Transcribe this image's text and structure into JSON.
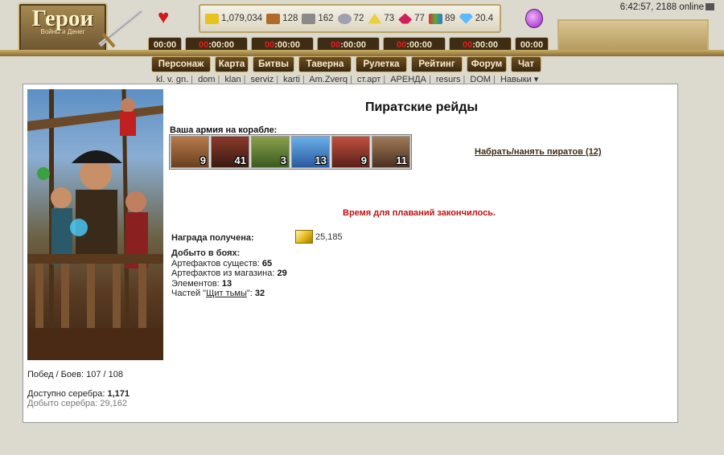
{
  "header": {
    "logo_title": "Герои",
    "logo_subtitle": "Войны и Денег",
    "clock": "6:42:57, 2188 online",
    "resources": [
      {
        "name": "gold",
        "value": "1,079,034",
        "color": "#e6c223"
      },
      {
        "name": "wood",
        "value": "128",
        "color": "#b06a2a"
      },
      {
        "name": "ore",
        "value": "162",
        "color": "#8a8a8a"
      },
      {
        "name": "mercury",
        "value": "72",
        "color": "#a0a0b0"
      },
      {
        "name": "sulfur",
        "value": "73",
        "color": "#e8d040"
      },
      {
        "name": "crystal",
        "value": "77",
        "color": "#d0205a"
      },
      {
        "name": "gems",
        "value": "89",
        "color": "#50b040"
      },
      {
        "name": "diamonds",
        "value": "20.4",
        "color": "#5ab8ff"
      }
    ],
    "timers": [
      {
        "prefix": "",
        "time": "00:00"
      },
      {
        "prefix": "00",
        "time": ":00:00"
      },
      {
        "prefix": "00",
        "time": ":00:00"
      },
      {
        "prefix": "00",
        "time": ":00:00"
      },
      {
        "prefix": "00",
        "time": ":00:00"
      },
      {
        "prefix": "00",
        "time": ":00:00"
      },
      {
        "prefix": "",
        "time": "00:00"
      }
    ],
    "nav": [
      "Персонаж",
      "Карта",
      "Битвы",
      "Таверна",
      "Рулетка",
      "Рейтинг",
      "Форум",
      "Чат"
    ],
    "links": [
      "kl. v. gn.",
      "dom",
      "klan",
      "serviz",
      "karti",
      "Am.Zverq",
      "ст.арт",
      "АРЕНДА",
      "resurs",
      "DOM",
      "Навыки ▾"
    ]
  },
  "main": {
    "title": "Пиратские рейды",
    "army_label": "Ваша армия на корабле:",
    "units": [
      {
        "name": "pirate-brawler",
        "count": "9",
        "color": "#b87a4a"
      },
      {
        "name": "pirate-captain",
        "count": "41",
        "color": "#8a3a2a"
      },
      {
        "name": "lizard-warrior",
        "count": "3",
        "color": "#6a8a3a"
      },
      {
        "name": "sea-bird",
        "count": "13",
        "color": "#3a7ac0"
      },
      {
        "name": "corsair",
        "count": "9",
        "color": "#a04030"
      },
      {
        "name": "buccaneer",
        "count": "11",
        "color": "#7a5a40"
      }
    ],
    "hire_link": "Набрать/нанять пиратов (12)",
    "notice": "Время для плаваний закончилось.",
    "reward_label": "Награда получена:",
    "reward_value": "25,185",
    "loot_title": "Добыто в боях:",
    "loot": {
      "creature_label": "Артефактов существ:",
      "creature_value": "65",
      "shop_label": "Артефактов из магазина:",
      "shop_value": "29",
      "elements_label": "Элементов:",
      "elements_value": "13",
      "parts_prefix": "Частей \"",
      "parts_link": "Щит тьмы",
      "parts_suffix": "\":",
      "parts_value": "32"
    },
    "stats": {
      "wins_label": "Побед / Боев:",
      "wins_value": "107 / 108",
      "silver_label": "Доступно серебра:",
      "silver_value": "1,171",
      "mined_label": "Добыто серебра:",
      "mined_value": "29,162"
    }
  }
}
